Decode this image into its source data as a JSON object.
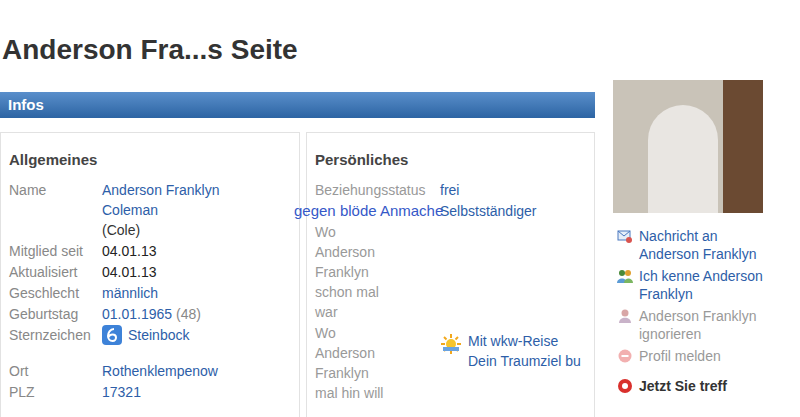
{
  "page_title": "Anderson Fra...s Seite",
  "section_bar": "Infos",
  "watermark": "gegen blöde Anmache",
  "general": {
    "title": "Allgemeines",
    "rows": [
      {
        "label": "Name",
        "value": "Anderson Franklyn Coleman",
        "note": "(Cole)",
        "link": true,
        "kind": "text"
      },
      {
        "label": "Mitglied seit",
        "value": "04.01.13",
        "link": false,
        "kind": "text"
      },
      {
        "label": "Aktualisiert",
        "value": "04.01.13",
        "link": false,
        "kind": "text"
      },
      {
        "label": "Geschlecht",
        "value": "männlich",
        "link": true,
        "kind": "text"
      },
      {
        "label": "Geburtstag",
        "value": "01.01.1965",
        "note": "(48)",
        "link": true,
        "kind": "text"
      },
      {
        "label": "Sternzeichen",
        "value": "Steinbock",
        "link": true,
        "kind": "zodiac"
      }
    ],
    "location_rows": [
      {
        "label": "Ort",
        "value": "Rothenklempenow",
        "link": true
      },
      {
        "label": "PLZ",
        "value": "17321",
        "link": true
      }
    ]
  },
  "personal": {
    "title": "Persönliches",
    "rows": [
      {
        "label": "Beziehungsstatus",
        "value": "frei"
      },
      {
        "value": "Selbstständiger"
      },
      {
        "label": "Wo Anderson Franklyn schon mal war"
      },
      {
        "label": "Wo Anderson Franklyn mal hin will",
        "promo": "Mit wkw-Reise Dein Traumziel bu"
      }
    ]
  },
  "actions": [
    {
      "text": "Nachricht an Anderson Franklyn",
      "disabled": false,
      "kind": "message"
    },
    {
      "text": "Ich kenne Anderson Franklyn",
      "disabled": false,
      "kind": "contact"
    },
    {
      "text": "Anderson Franklyn ignorieren",
      "disabled": true,
      "kind": "ignore"
    },
    {
      "text": "Profil melden",
      "disabled": true,
      "kind": "report"
    },
    {
      "text": "Jetzt Sie treff",
      "disabled": false,
      "kind": "meet"
    }
  ]
}
